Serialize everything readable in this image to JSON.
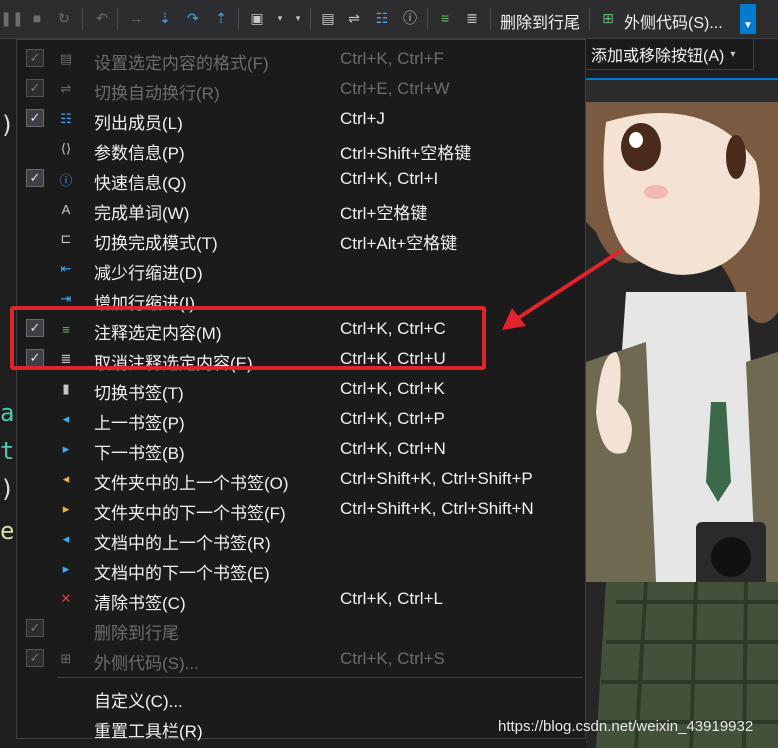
{
  "toolbar": {
    "delete_to_eol": "删除到行尾",
    "surround_with": "外侧代码(S)...",
    "overflow_icon": "dropdown-arrow-icon",
    "colors": {
      "background": "#2d2d30",
      "accent": "#007acc"
    }
  },
  "submenu": {
    "add_remove_label": "添加或移除按钮(A)"
  },
  "editor": {
    "code_chars": [
      ")",
      "a",
      "t",
      ")",
      "e"
    ]
  },
  "watermark": "https://blog.csdn.net/weixin_43919932",
  "menu": {
    "items": [
      {
        "label": "设置选定内容的格式(F)",
        "shortcut": "Ctrl+K, Ctrl+F",
        "checked": true,
        "disabled": true,
        "icon": "format-selection-icon"
      },
      {
        "label": "切换自动换行(R)",
        "shortcut": "Ctrl+E, Ctrl+W",
        "checked": true,
        "disabled": true,
        "icon": "word-wrap-icon"
      },
      {
        "label": "列出成员(L)",
        "shortcut": "Ctrl+J",
        "checked": true,
        "disabled": false,
        "icon": "list-members-icon"
      },
      {
        "label": "参数信息(P)",
        "shortcut": "Ctrl+Shift+空格键",
        "checked": false,
        "disabled": false,
        "icon": "parameter-info-icon"
      },
      {
        "label": "快速信息(Q)",
        "shortcut": "Ctrl+K, Ctrl+I",
        "checked": true,
        "disabled": false,
        "icon": "quick-info-icon"
      },
      {
        "label": "完成单词(W)",
        "shortcut": "Ctrl+空格键",
        "checked": false,
        "disabled": false,
        "icon": "complete-word-icon"
      },
      {
        "label": "切换完成模式(T)",
        "shortcut": "Ctrl+Alt+空格键",
        "checked": false,
        "disabled": false,
        "icon": "completion-mode-icon"
      },
      {
        "label": "减少行缩进(D)",
        "shortcut": "",
        "checked": false,
        "disabled": false,
        "icon": "decrease-indent-icon"
      },
      {
        "label": "增加行缩进(I)",
        "shortcut": "",
        "checked": false,
        "disabled": false,
        "icon": "increase-indent-icon"
      },
      {
        "label": "注释选定内容(M)",
        "shortcut": "Ctrl+K, Ctrl+C",
        "checked": true,
        "disabled": false,
        "icon": "comment-icon"
      },
      {
        "label": "取消注释选定内容(E)",
        "shortcut": "Ctrl+K, Ctrl+U",
        "checked": true,
        "disabled": false,
        "icon": "uncomment-icon"
      },
      {
        "label": "切换书签(T)",
        "shortcut": "Ctrl+K, Ctrl+K",
        "checked": false,
        "disabled": false,
        "icon": "bookmark-icon"
      },
      {
        "label": "上一书签(P)",
        "shortcut": "Ctrl+K, Ctrl+P",
        "checked": false,
        "disabled": false,
        "icon": "previous-bookmark-icon"
      },
      {
        "label": "下一书签(B)",
        "shortcut": "Ctrl+K, Ctrl+N",
        "checked": false,
        "disabled": false,
        "icon": "next-bookmark-icon"
      },
      {
        "label": "文件夹中的上一个书签(O)",
        "shortcut": "Ctrl+Shift+K, Ctrl+Shift+P",
        "checked": false,
        "disabled": false,
        "icon": "folder-previous-bookmark-icon"
      },
      {
        "label": "文件夹中的下一个书签(F)",
        "shortcut": "Ctrl+Shift+K, Ctrl+Shift+N",
        "checked": false,
        "disabled": false,
        "icon": "folder-next-bookmark-icon"
      },
      {
        "label": "文档中的上一个书签(R)",
        "shortcut": "",
        "checked": false,
        "disabled": false,
        "icon": "document-previous-bookmark-icon"
      },
      {
        "label": "文档中的下一个书签(E)",
        "shortcut": "",
        "checked": false,
        "disabled": false,
        "icon": "document-next-bookmark-icon"
      },
      {
        "label": "清除书签(C)",
        "shortcut": "Ctrl+K, Ctrl+L",
        "checked": false,
        "disabled": false,
        "icon": "clear-bookmarks-icon"
      },
      {
        "label": "删除到行尾",
        "shortcut": "",
        "checked": true,
        "disabled": true,
        "icon": "delete-to-eol-icon"
      },
      {
        "label": "外侧代码(S)...",
        "shortcut": "Ctrl+K, Ctrl+S",
        "checked": true,
        "disabled": true,
        "icon": "surround-with-icon"
      }
    ],
    "customize_label": "自定义(C)...",
    "reset_label": "重置工具栏(R)"
  },
  "annotation": {
    "highlight_color": "#e0242b"
  }
}
